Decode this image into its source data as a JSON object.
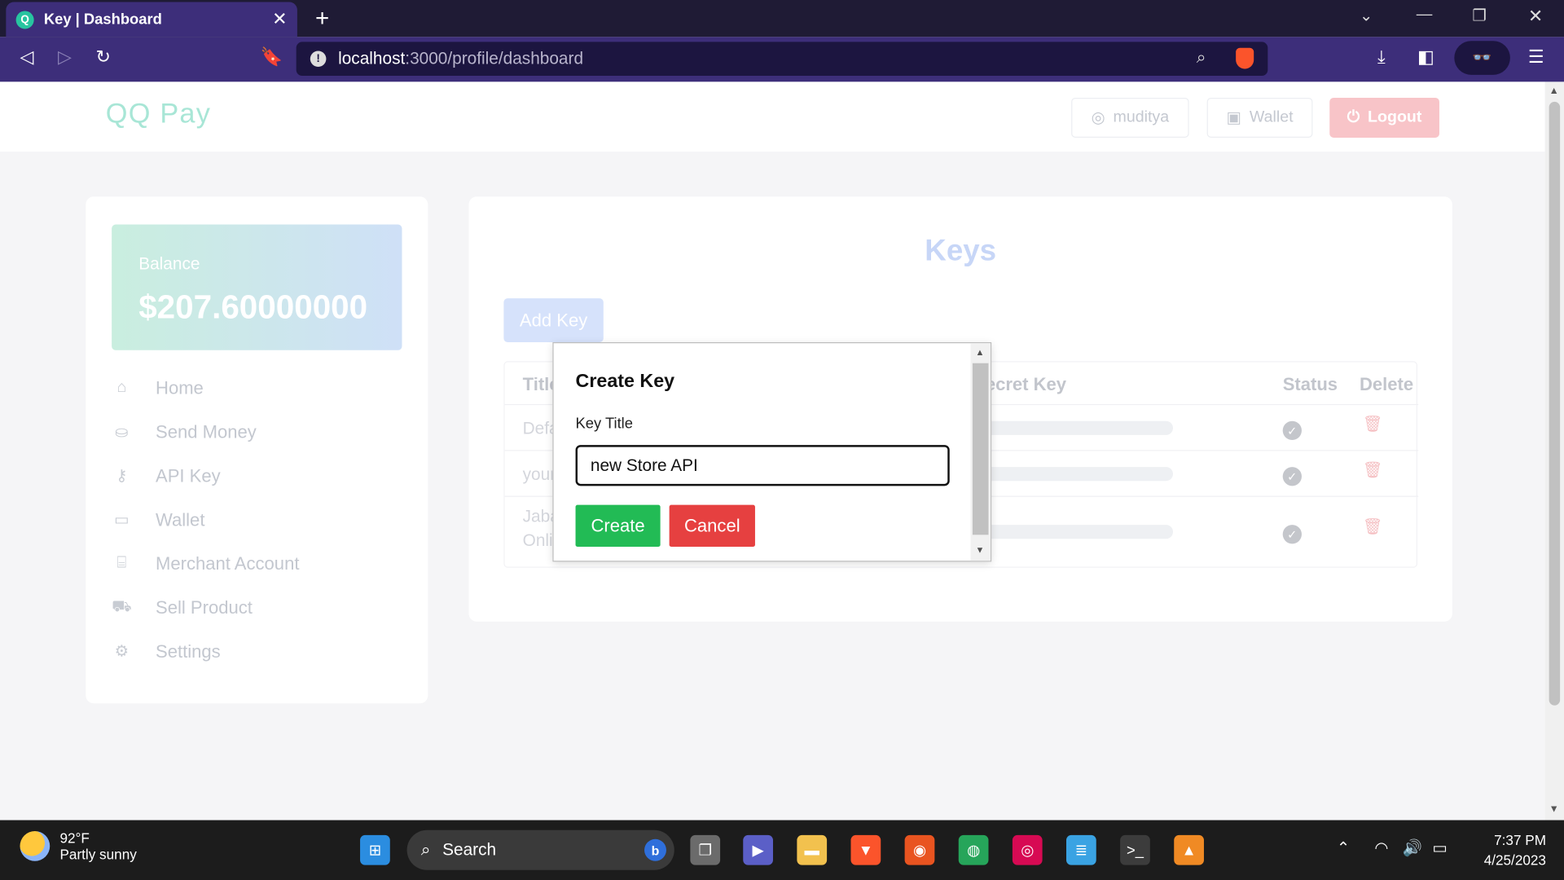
{
  "browser": {
    "tab_title": "Key | Dashboard",
    "url_host": "localhost",
    "url_path": ":3000/profile/dashboard"
  },
  "header": {
    "logo": "QQ Pay",
    "user_label": "muditya",
    "wallet_label": "Wallet",
    "logout_label": "Logout"
  },
  "sidebar": {
    "balance_label": "Balance",
    "balance_amount": "$207.60000000",
    "items": [
      {
        "label": "Home",
        "icon": "home-icon"
      },
      {
        "label": "Send Money",
        "icon": "send-money-icon"
      },
      {
        "label": "API Key",
        "icon": "key-icon"
      },
      {
        "label": "Wallet",
        "icon": "credit-card-icon"
      },
      {
        "label": "Merchant Account",
        "icon": "store-icon"
      },
      {
        "label": "Sell Product",
        "icon": "cart-icon"
      },
      {
        "label": "Settings",
        "icon": "gear-icon"
      }
    ]
  },
  "keys_panel": {
    "title": "Keys",
    "add_key_label": "Add Key",
    "columns": [
      "Title",
      "Secret Key",
      "Status",
      "Delete"
    ],
    "rows": [
      {
        "title": "Default"
      },
      {
        "title": "your"
      },
      {
        "title": "Jabar Online"
      }
    ]
  },
  "modal": {
    "heading": "Create Key",
    "field_label": "Key Title",
    "field_value": "new Store API",
    "create_label": "Create",
    "cancel_label": "Cancel"
  },
  "taskbar": {
    "temperature": "92°F",
    "weather": "Partly sunny",
    "search_label": "Search",
    "time": "7:37 PM",
    "date": "4/25/2023"
  },
  "colors": {
    "browser_accent": "#3d2e7a",
    "create_button": "#22bb55",
    "cancel_button": "#e64040",
    "logout_button": "#f8c4c8"
  }
}
